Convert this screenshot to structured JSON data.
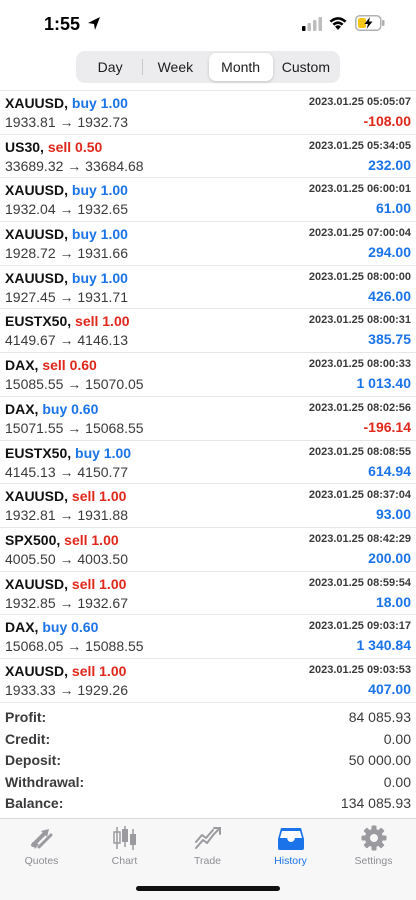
{
  "status_bar": {
    "time": "1:55",
    "icons": [
      "location-arrow-icon",
      "cellular-signal-icon",
      "wifi-icon",
      "battery-charging-icon"
    ]
  },
  "period_tabs": {
    "selected": "Month",
    "items": [
      "Day",
      "Week",
      "Month",
      "Custom"
    ]
  },
  "trades": [
    {
      "symbol": "XAUUSD,",
      "side": "buy",
      "volume": "buy 1.00",
      "prices": "1933.81 → 1932.73",
      "time": "2023.01.25 05:05:07",
      "profit": "-108.00"
    },
    {
      "symbol": "US30,",
      "side": "sell",
      "volume": "sell 0.50",
      "prices": "33689.32 → 33684.68",
      "time": "2023.01.25 05:34:05",
      "profit": "232.00"
    },
    {
      "symbol": "XAUUSD,",
      "side": "buy",
      "volume": "buy 1.00",
      "prices": "1932.04 → 1932.65",
      "time": "2023.01.25 06:00:01",
      "profit": "61.00"
    },
    {
      "symbol": "XAUUSD,",
      "side": "buy",
      "volume": "buy 1.00",
      "prices": "1928.72 → 1931.66",
      "time": "2023.01.25 07:00:04",
      "profit": "294.00"
    },
    {
      "symbol": "XAUUSD,",
      "side": "buy",
      "volume": "buy 1.00",
      "prices": "1927.45 → 1931.71",
      "time": "2023.01.25 08:00:00",
      "profit": "426.00"
    },
    {
      "symbol": "EUSTX50,",
      "side": "sell",
      "volume": "sell 1.00",
      "prices": "4149.67 → 4146.13",
      "time": "2023.01.25 08:00:31",
      "profit": "385.75"
    },
    {
      "symbol": "DAX,",
      "side": "sell",
      "volume": "sell 0.60",
      "prices": "15085.55 → 15070.05",
      "time": "2023.01.25 08:00:33",
      "profit": "1 013.40"
    },
    {
      "symbol": "DAX,",
      "side": "buy",
      "volume": "buy 0.60",
      "prices": "15071.55 → 15068.55",
      "time": "2023.01.25 08:02:56",
      "profit": "-196.14"
    },
    {
      "symbol": "EUSTX50,",
      "side": "buy",
      "volume": "buy 1.00",
      "prices": "4145.13 → 4150.77",
      "time": "2023.01.25 08:08:55",
      "profit": "614.94"
    },
    {
      "symbol": "XAUUSD,",
      "side": "sell",
      "volume": "sell 1.00",
      "prices": "1932.81 → 1931.88",
      "time": "2023.01.25 08:37:04",
      "profit": "93.00"
    },
    {
      "symbol": "SPX500,",
      "side": "sell",
      "volume": "sell 1.00",
      "prices": "4005.50 → 4003.50",
      "time": "2023.01.25 08:42:29",
      "profit": "200.00"
    },
    {
      "symbol": "XAUUSD,",
      "side": "sell",
      "volume": "sell 1.00",
      "prices": "1932.85 → 1932.67",
      "time": "2023.01.25 08:59:54",
      "profit": "18.00"
    },
    {
      "symbol": "DAX,",
      "side": "buy",
      "volume": "buy 0.60",
      "prices": "15068.05 → 15088.55",
      "time": "2023.01.25 09:03:17",
      "profit": "1 340.84"
    },
    {
      "symbol": "XAUUSD,",
      "side": "sell",
      "volume": "sell 1.00",
      "prices": "1933.33 → 1929.26",
      "time": "2023.01.25 09:03:53",
      "profit": "407.00"
    }
  ],
  "summary": {
    "profit_label": "Profit:",
    "profit_value": "84 085.93",
    "credit_label": "Credit:",
    "credit_value": "0.00",
    "deposit_label": "Deposit:",
    "deposit_value": "50 000.00",
    "withdrawal_label": "Withdrawal:",
    "withdrawal_value": "0.00",
    "balance_label": "Balance:",
    "balance_value": "134 085.93"
  },
  "tabbar": {
    "selected": "History",
    "items": [
      {
        "label": "Quotes",
        "icon": "quotes-arrows-icon"
      },
      {
        "label": "Chart",
        "icon": "candlestick-chart-icon"
      },
      {
        "label": "Trade",
        "icon": "trade-line-chart-icon"
      },
      {
        "label": "History",
        "icon": "inbox-tray-icon"
      },
      {
        "label": "Settings",
        "icon": "gear-icon"
      }
    ]
  },
  "colors": {
    "buy": "#1a73e8",
    "sell": "#e0271b",
    "profit_positive": "#1a73e8",
    "profit_negative": "#e0271b",
    "tab_active": "#1a73e8",
    "tab_inactive": "#8e8e93"
  }
}
